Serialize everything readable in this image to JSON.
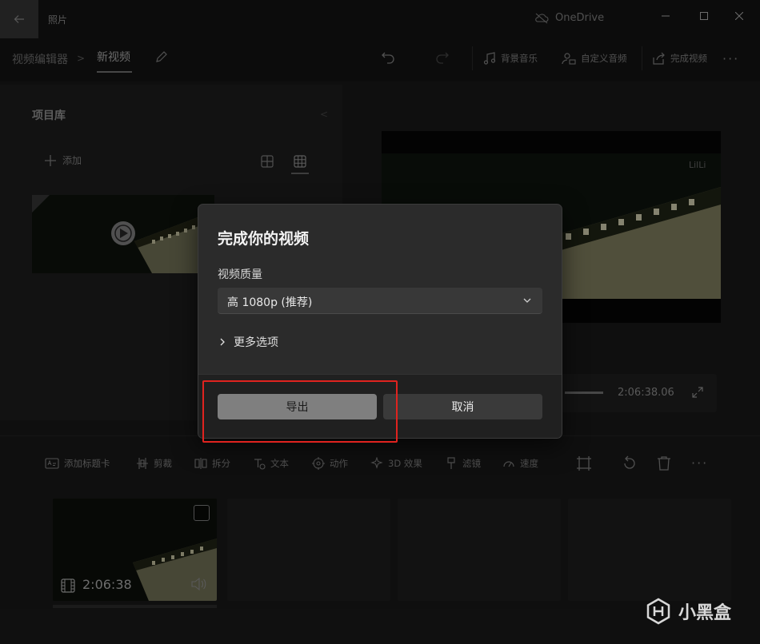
{
  "app": {
    "title": "照片",
    "onedrive_label": "OneDrive"
  },
  "breadcrumb": {
    "root": "视频编辑器",
    "current": "新视频"
  },
  "toolbar": {
    "background_music": "背景音乐",
    "custom_audio": "自定义音频",
    "finish_video": "完成视频"
  },
  "library": {
    "title": "项目库",
    "add_label": "添加"
  },
  "preview": {
    "watermark_text": "LilLi",
    "time": "2:06:38.06"
  },
  "edit_toolbar": {
    "add_title_card": "添加标题卡",
    "trim": "剪裁",
    "split": "拆分",
    "text": "文本",
    "motion": "动作",
    "effects_3d": "3D 效果",
    "filters": "滤镜",
    "speed": "速度"
  },
  "storyboard": {
    "clip_duration": "2:06:38"
  },
  "dialog": {
    "title": "完成你的视频",
    "quality_label": "视频质量",
    "quality_value": "高 1080p (推荐)",
    "more_options": "更多选项",
    "export_label": "导出",
    "cancel_label": "取消"
  },
  "watermark": {
    "brand": "小黑盒"
  },
  "colors": {
    "highlight": "#e0231f",
    "dialog_bg": "#2b2b2b",
    "export_btn": "#7f7f7f"
  }
}
